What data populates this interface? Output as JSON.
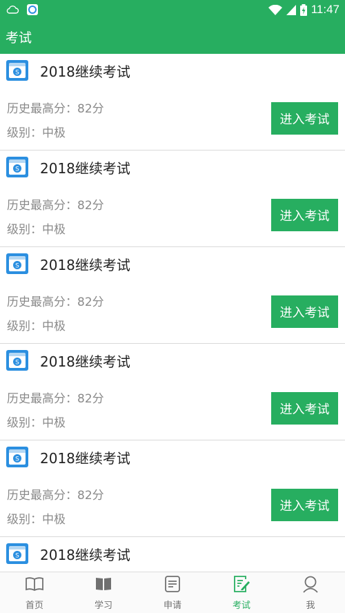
{
  "status": {
    "time": "11:47"
  },
  "header": {
    "title": "考试"
  },
  "exam_button_label": "进入考试",
  "exams": [
    {
      "title": "2018继续考试",
      "score": "历史最高分：82分",
      "level": "级别：中极"
    },
    {
      "title": "2018继续考试",
      "score": "历史最高分：82分",
      "level": "级别：中极"
    },
    {
      "title": "2018继续考试",
      "score": "历史最高分：82分",
      "level": "级别：中极"
    },
    {
      "title": "2018继续考试",
      "score": "历史最高分：82分",
      "level": "级别：中极"
    },
    {
      "title": "2018继续考试",
      "score": "历史最高分：82分",
      "level": "级别：中极"
    },
    {
      "title": "2018继续考试",
      "score": "",
      "level": ""
    }
  ],
  "tabs": [
    {
      "label": "首页",
      "icon": "open-book-icon",
      "active": false
    },
    {
      "label": "学习",
      "icon": "book-icon",
      "active": false
    },
    {
      "label": "申请",
      "icon": "document-icon",
      "active": false
    },
    {
      "label": "考试",
      "icon": "edit-document-icon",
      "active": true
    },
    {
      "label": "我",
      "icon": "user-icon",
      "active": false
    }
  ],
  "colors": {
    "primary": "#27ae60",
    "icon_blue": "#2b8fe0"
  }
}
